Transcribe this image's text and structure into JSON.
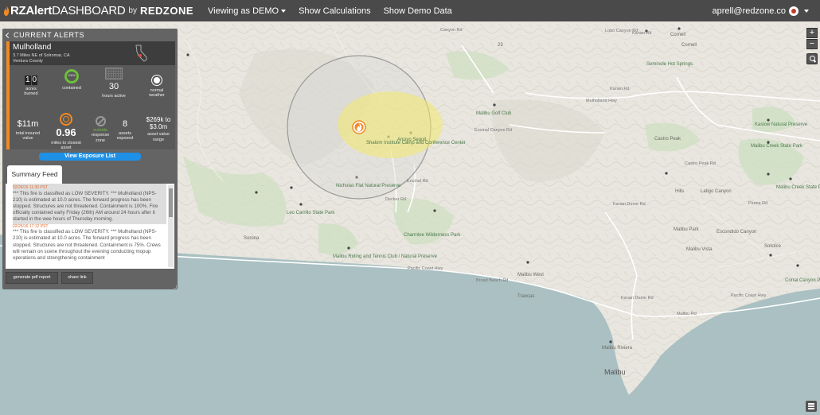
{
  "nav": {
    "brand_rz": "RZAlert",
    "brand_dash": "DASHBOARD",
    "brand_by": "by",
    "brand_redzone": "REDZONE",
    "viewing": "Viewing as DEMO",
    "calc": "Show Calculations",
    "demo": "Show Demo Data",
    "user": "aprell@redzone.co"
  },
  "map": {
    "zoom_in": "+",
    "zoom_out": "−",
    "labels": {
      "canyon_rd": "Canyon Rd",
      "lobo": "Lobo Canyon Rd",
      "kanan1": "Kanan Rd",
      "cornell1": "Cornell",
      "cornell2": "Cornell",
      "seminole": "Seminole Hot Springs",
      "mulholland_hwy": "Mulholland Hwy",
      "malibu_golf": "Malibu Golf Club",
      "encinal": "Encinal Canyon Rd",
      "arroyo": "Arroyo Sequit",
      "shalom": "Shalom Institute Camp and Conference Center",
      "nicholas": "Nicholas Flat Natural Preserve",
      "decker": "Decker Rd",
      "encinal2": "Encinal Rd",
      "leo": "Leo Carrillo State Park",
      "charmlee": "Charmlee Wilderness Park",
      "malibu_riding": "Malibu Riding and Tennis Club / Natural Preserve",
      "pch1": "Pacific Coast Hwy",
      "broad": "Broad Beach Rd",
      "malibu_west": "Malibu West",
      "trancas": "Trancas",
      "kanan_dume": "Kanan Dume Rd",
      "kanan_dume2": "Kanan Dume Rd",
      "castro": "Castro Peak",
      "castro_rd": "Castro Peak Rd",
      "mal_creek": "Malibu Creek State Park",
      "mal_creek2": "Malibu Creek State Park",
      "malibu_park": "Malibu Park",
      "malibu_vista": "Malibu Vista",
      "pch2": "Pacific Coast Hwy",
      "malibu_riviera": "Malibu Riviera",
      "malibu": "Malibu",
      "corral": "Corral Canyon Park",
      "solstice": "Solstice",
      "sorona": "Sorona",
      "hwy23": "23",
      "kanan2": "Kanan Rd",
      "piuma": "Piuma Rd",
      "latigo": "Latigo Canyon",
      "hills": "Hills",
      "malibu_rd": "Malibu Rd",
      "escondido": "Escondido Canyon",
      "kaslow": "Kaslow Natural Preserve"
    }
  },
  "panel": {
    "header": "CURRENT ALERTS",
    "alert": {
      "name": "Mulholland",
      "distance": "3.7 Miles NE of Solromar, CA",
      "county": "Ventura County",
      "acres_digit1": "1",
      "acres_digit2": "0",
      "acres_label": "acres burned",
      "contained_label": "contained",
      "hours_value": "30",
      "hours_label": "hours active",
      "weather_label": "normal weather",
      "insured_value": "$11m",
      "insured_label": "total insured value",
      "miles_value": "0.96",
      "miles_label": "miles to closest asset",
      "response_value": "outside",
      "response_label": "response zone",
      "assets_value": "8",
      "assets_label": "assets exposed",
      "range_value": "$269k to $3.0m",
      "range_label": "asset value range"
    },
    "exposure_btn": "View Exposure List",
    "feed_tab": "Summary Feed",
    "feed": [
      {
        "date": "02/26/16 11:30 PST",
        "text": "*** This fire is classified as LOW SEVERITY. *** Mulholland (NPS-210) is estimated at 10.0 acres. The forward progress has been stopped. Structures are not threatened. Containment is 100%. Fire officially contained early Friday (26th) AM around 24 hours after it started in the wee hours of Thursday morning."
      },
      {
        "date": "02/25/16 17:12 PST",
        "text": "*** This fire is classified as LOW SEVERITY. *** Mulholland (NPS-210) is estimated at 10.0 acres. The forward progress has been stopped. Structures are not threatened. Containment is 75%. Crews will remain on scene throughout the evening conducting mopup operations and strengthening containment"
      }
    ],
    "pdf_btn": "generate pdf report",
    "share_btn": "share link"
  },
  "colors": {
    "nav_bg": "#4a4a4a",
    "panel_bg": "#646464",
    "alert_accent": "#f08a24",
    "button_blue": "#1e90e6",
    "contained_green": "#6fbf3c",
    "ocean": "#aac0c2",
    "land": "#e8e6df",
    "fire_zone": "#f2e96b"
  }
}
